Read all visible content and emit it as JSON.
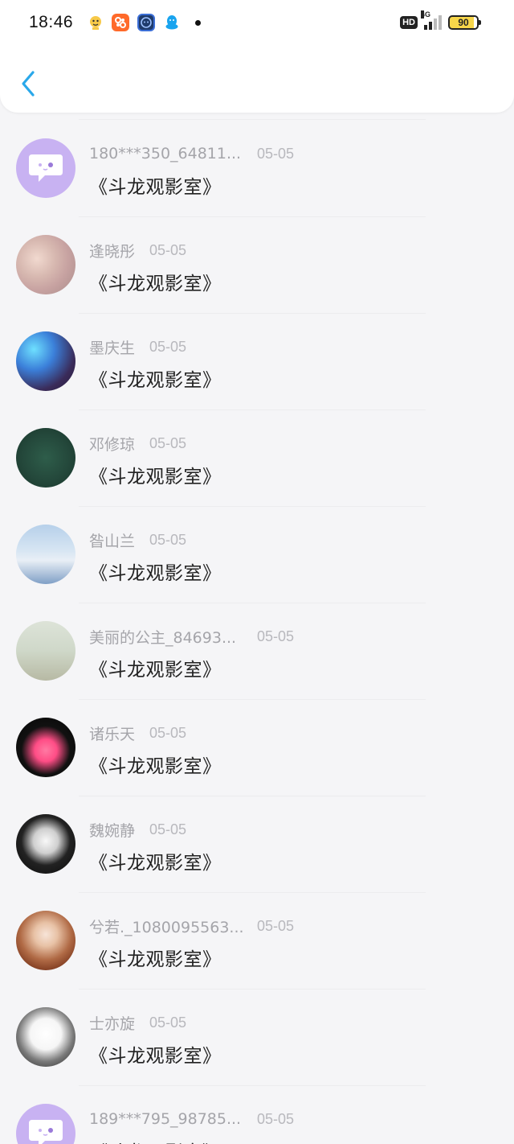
{
  "status_bar": {
    "time": "18:46",
    "network_badge": "HD",
    "network_type": "4G",
    "battery_level": "90",
    "battery_color": "#f7d64a"
  },
  "header": {
    "back_icon": "chevron-left-icon",
    "accent": "#2aa8ea"
  },
  "rows": [
    {
      "name": "180***350_64811...",
      "date": "05-05",
      "message": "《斗龙观影室》"
    },
    {
      "name": "逢晓彤",
      "date": "05-05",
      "message": "《斗龙观影室》"
    },
    {
      "name": "墨庆生",
      "date": "05-05",
      "message": "《斗龙观影室》"
    },
    {
      "name": "邓修琼",
      "date": "05-05",
      "message": "《斗龙观影室》"
    },
    {
      "name": "昝山兰",
      "date": "05-05",
      "message": "《斗龙观影室》"
    },
    {
      "name": "美丽的公主_84693...",
      "date": "05-05",
      "message": "《斗龙观影室》"
    },
    {
      "name": "诸乐天",
      "date": "05-05",
      "message": "《斗龙观影室》"
    },
    {
      "name": "魏婉静",
      "date": "05-05",
      "message": "《斗龙观影室》"
    },
    {
      "name": "兮若._1080095563...",
      "date": "05-05",
      "message": "《斗龙观影室》"
    },
    {
      "name": "士亦旋",
      "date": "05-05",
      "message": "《斗龙观影室》"
    },
    {
      "name": "189***795_98785...",
      "date": "05-05",
      "message": "《斗龙观影室》"
    }
  ]
}
